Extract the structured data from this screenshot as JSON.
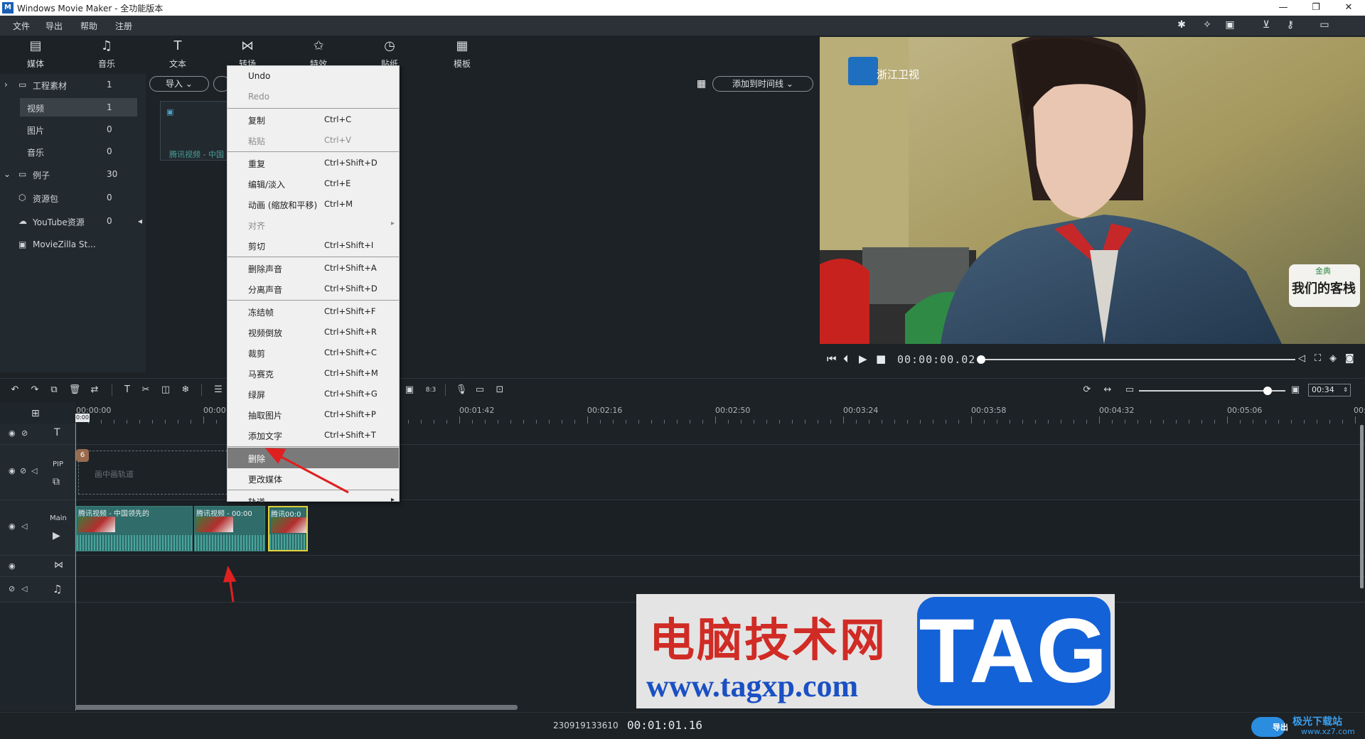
{
  "window": {
    "title": "Windows Movie Maker  - 全功能版本",
    "app_icon": "M"
  },
  "menu": [
    "文件",
    "导出",
    "帮助",
    "注册"
  ],
  "tabs": [
    {
      "label": "媒体",
      "icon": "media-icon"
    },
    {
      "label": "音乐",
      "icon": "music-icon"
    },
    {
      "label": "文本",
      "icon": "text-icon"
    },
    {
      "label": "转场",
      "icon": "transition-icon"
    },
    {
      "label": "特效",
      "icon": "effects-icon"
    },
    {
      "label": "贴纸",
      "icon": "sticker-icon"
    },
    {
      "label": "模板",
      "icon": "template-icon"
    }
  ],
  "tree": [
    {
      "label": "工程素材",
      "count": "1"
    },
    {
      "label": "视频",
      "count": "1"
    },
    {
      "label": "图片",
      "count": "0"
    },
    {
      "label": "音乐",
      "count": "0"
    },
    {
      "label": "例子",
      "count": "30"
    },
    {
      "label": "资源包",
      "count": "0"
    },
    {
      "label": "YouTube资源",
      "count": "0"
    },
    {
      "label": "MovieZilla St...",
      "count": ""
    }
  ],
  "library": {
    "import_label": "导入",
    "add_to_timeline_label": "添加到时间线",
    "thumb_caption": "腾讯视频 - 中国"
  },
  "preview": {
    "channel_logo_text": "浙江卫视",
    "show_badge_top": "金典",
    "show_badge_bottom": "我们的客栈",
    "timecode": "00:00:00.02",
    "progress": 0.0
  },
  "timeline": {
    "ruler_labels": [
      "00:00:00",
      "00:00",
      "00:01:42",
      "00:02:16",
      "00:02:50",
      "00:03:24",
      "00:03:58",
      "00:04:32",
      "00:05:06",
      "00:"
    ],
    "playhead_label": "0:00",
    "zoom_value": "00:34",
    "zoom_level": 0.88,
    "pip_label": "PIP",
    "main_label": "Main",
    "pip_placeholder": "画中画轨道",
    "clips": [
      {
        "label": "腾讯视频 - 中国领先的"
      },
      {
        "label": "腾讯视频 -  00:00"
      },
      {
        "label": "腾讯00:0"
      }
    ],
    "clip_number_badge": "6"
  },
  "context_menu": [
    {
      "label": "Undo",
      "shortcut": "",
      "enabled": true
    },
    {
      "label": "Redo",
      "shortcut": "",
      "enabled": false
    },
    {
      "label": "复制",
      "shortcut": "Ctrl+C",
      "enabled": true
    },
    {
      "label": "粘贴",
      "shortcut": "Ctrl+V",
      "enabled": false
    },
    {
      "label": "重复",
      "shortcut": "Ctrl+Shift+D",
      "enabled": true
    },
    {
      "label": "编辑/淡入",
      "shortcut": "Ctrl+E",
      "enabled": true
    },
    {
      "label": "动画 (缩放和平移)",
      "shortcut": "Ctrl+M",
      "enabled": true
    },
    {
      "label": "对齐",
      "shortcut": "",
      "enabled": false
    },
    {
      "label": "剪切",
      "shortcut": "Ctrl+Shift+I",
      "enabled": true
    },
    {
      "label": "删除声音",
      "shortcut": "Ctrl+Shift+A",
      "enabled": true
    },
    {
      "label": "分离声音",
      "shortcut": "Ctrl+Shift+D",
      "enabled": true
    },
    {
      "label": "冻结帧",
      "shortcut": "Ctrl+Shift+F",
      "enabled": true
    },
    {
      "label": "视频倒放",
      "shortcut": "Ctrl+Shift+R",
      "enabled": true
    },
    {
      "label": "裁剪",
      "shortcut": "Ctrl+Shift+C",
      "enabled": true
    },
    {
      "label": "马赛克",
      "shortcut": "Ctrl+Shift+M",
      "enabled": true
    },
    {
      "label": "绿屏",
      "shortcut": "Ctrl+Shift+G",
      "enabled": true
    },
    {
      "label": "抽取图片",
      "shortcut": "Ctrl+Shift+P",
      "enabled": true
    },
    {
      "label": "添加文字",
      "shortcut": "Ctrl+Shift+T",
      "enabled": true
    },
    {
      "label": "删除",
      "shortcut": "",
      "enabled": true,
      "highlighted": true
    },
    {
      "label": "更改媒体",
      "shortcut": "",
      "enabled": true
    },
    {
      "label": "轨道",
      "shortcut": "",
      "enabled": true
    }
  ],
  "watermark": {
    "cn_text": "电脑技术网",
    "url": "www.tagxp.com",
    "tag": "TAG",
    "corner_text": "极光下载站",
    "corner_url": "www.xz7.com",
    "corner_export": "导出"
  },
  "status": {
    "project_id": "230919133610",
    "duration": "00:01:01.16"
  },
  "colors": {
    "accent_teal": "#2f6c6a",
    "annotation_red": "#e02020",
    "watermark_blue": "#1462d8",
    "watermark_red": "#d02b25"
  }
}
